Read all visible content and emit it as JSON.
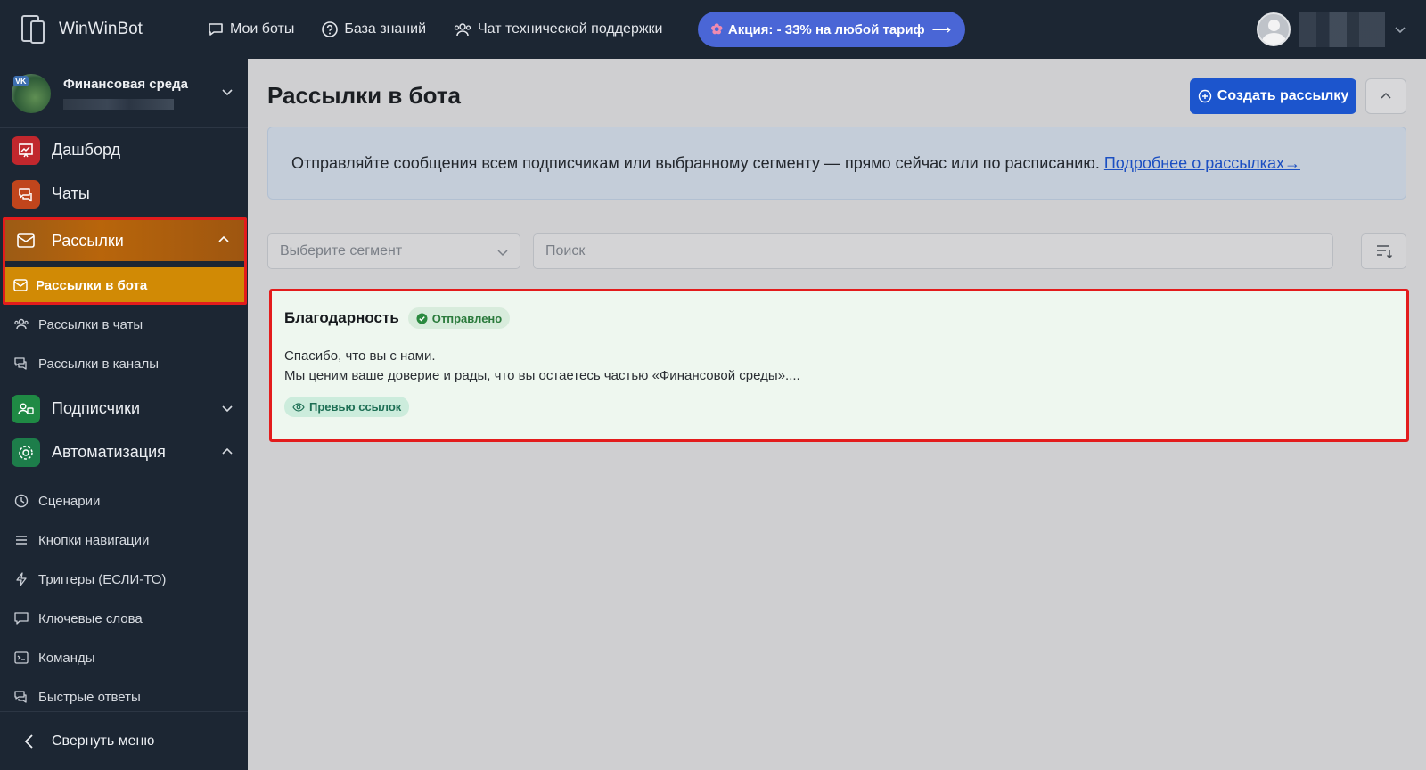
{
  "header": {
    "brand": "WinWinBot",
    "nav": {
      "my_bots": "Мои боты",
      "knowledge_base": "База знаний",
      "support_chat": "Чат технической поддержки"
    },
    "promo": "Акция: - 33% на любой тариф",
    "promo_arrow": "⟶"
  },
  "sidebar": {
    "bot_name": "Финансовая среда",
    "bot_badge": "VK",
    "items": {
      "dashboard": "Дашборд",
      "chats": "Чаты",
      "mailings": "Рассылки",
      "mailings_bot": "Рассылки в бота",
      "mailings_chats": "Рассылки в чаты",
      "mailings_channels": "Рассылки в каналы",
      "subscribers": "Подписчики",
      "automation": "Автоматизация",
      "scenarios": "Сценарии",
      "nav_buttons": "Кнопки навигации",
      "triggers": "Триггеры (ЕСЛИ-ТО)",
      "keywords": "Ключевые слова",
      "commands": "Команды",
      "quick_replies": "Быстрые ответы"
    },
    "collapse": "Свернуть меню"
  },
  "main": {
    "title": "Рассылки в бота",
    "create_button": "Создать рассылку",
    "info_text": "Отправляйте сообщения всем подписчикам или выбранному сегменту — прямо сейчас или по расписанию.",
    "info_link": "Подробнее о рассылках→",
    "segment_placeholder": "Выберите сегмент",
    "search_placeholder": "Поиск",
    "mailings": [
      {
        "title": "Благодарность",
        "status": "Отправлено",
        "line1": "Спасибо, что вы с нами.",
        "line2": "Мы ценим ваше доверие и рады, что вы остаетесь частью «Финансовой среды»....",
        "tag": "Превью ссылок"
      }
    ]
  },
  "colors": {
    "topbar": "#1c2633",
    "accent_blue": "#1c55cd",
    "active_orange": "#d18a05",
    "highlight_red": "#e31c1c",
    "success_green": "#2a7a3b"
  }
}
